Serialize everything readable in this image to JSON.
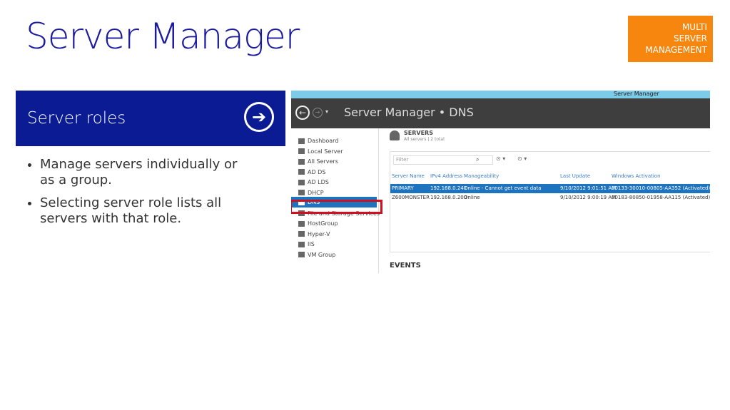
{
  "title": "Server Manager",
  "badge": [
    "MULTI",
    "SERVER",
    "MANAGEMENT"
  ],
  "roles": {
    "label": "Server roles",
    "arrow": "➔"
  },
  "bullets": [
    "Manage servers individually or as a group.",
    "Selecting server role lists all servers with that role."
  ],
  "screenshot": {
    "window_title": "Server Manager",
    "breadcrumb": "Server Manager • DNS",
    "nav": [
      "Dashboard",
      "Local Server",
      "All Servers",
      "AD DS",
      "AD LDS",
      "DHCP",
      "DNS",
      "File and Storage Services",
      "HostGroup",
      "Hyper-V",
      "IIS",
      "VM Group"
    ],
    "selected_nav": "DNS",
    "servers_title": "SERVERS",
    "servers_subtitle": "All servers | 2 total",
    "filter_placeholder": "Filter",
    "columns": [
      "Server Name",
      "IPv4 Address",
      "Manageability",
      "Last Update",
      "Windows Activation"
    ],
    "rows": [
      [
        "PRIMARY",
        "192.168.0.241",
        "Online - Cannot get event data",
        "9/10/2012 9:01:51 AM",
        "00133-30010-00805-AA352 (Activated)"
      ],
      [
        "Z600MONSTER",
        "192.168.0.200",
        "Online",
        "9/10/2012 9:00:19 AM",
        "00183-80850-01958-AA115 (Activated)"
      ]
    ],
    "events_title": "EVENTS"
  }
}
